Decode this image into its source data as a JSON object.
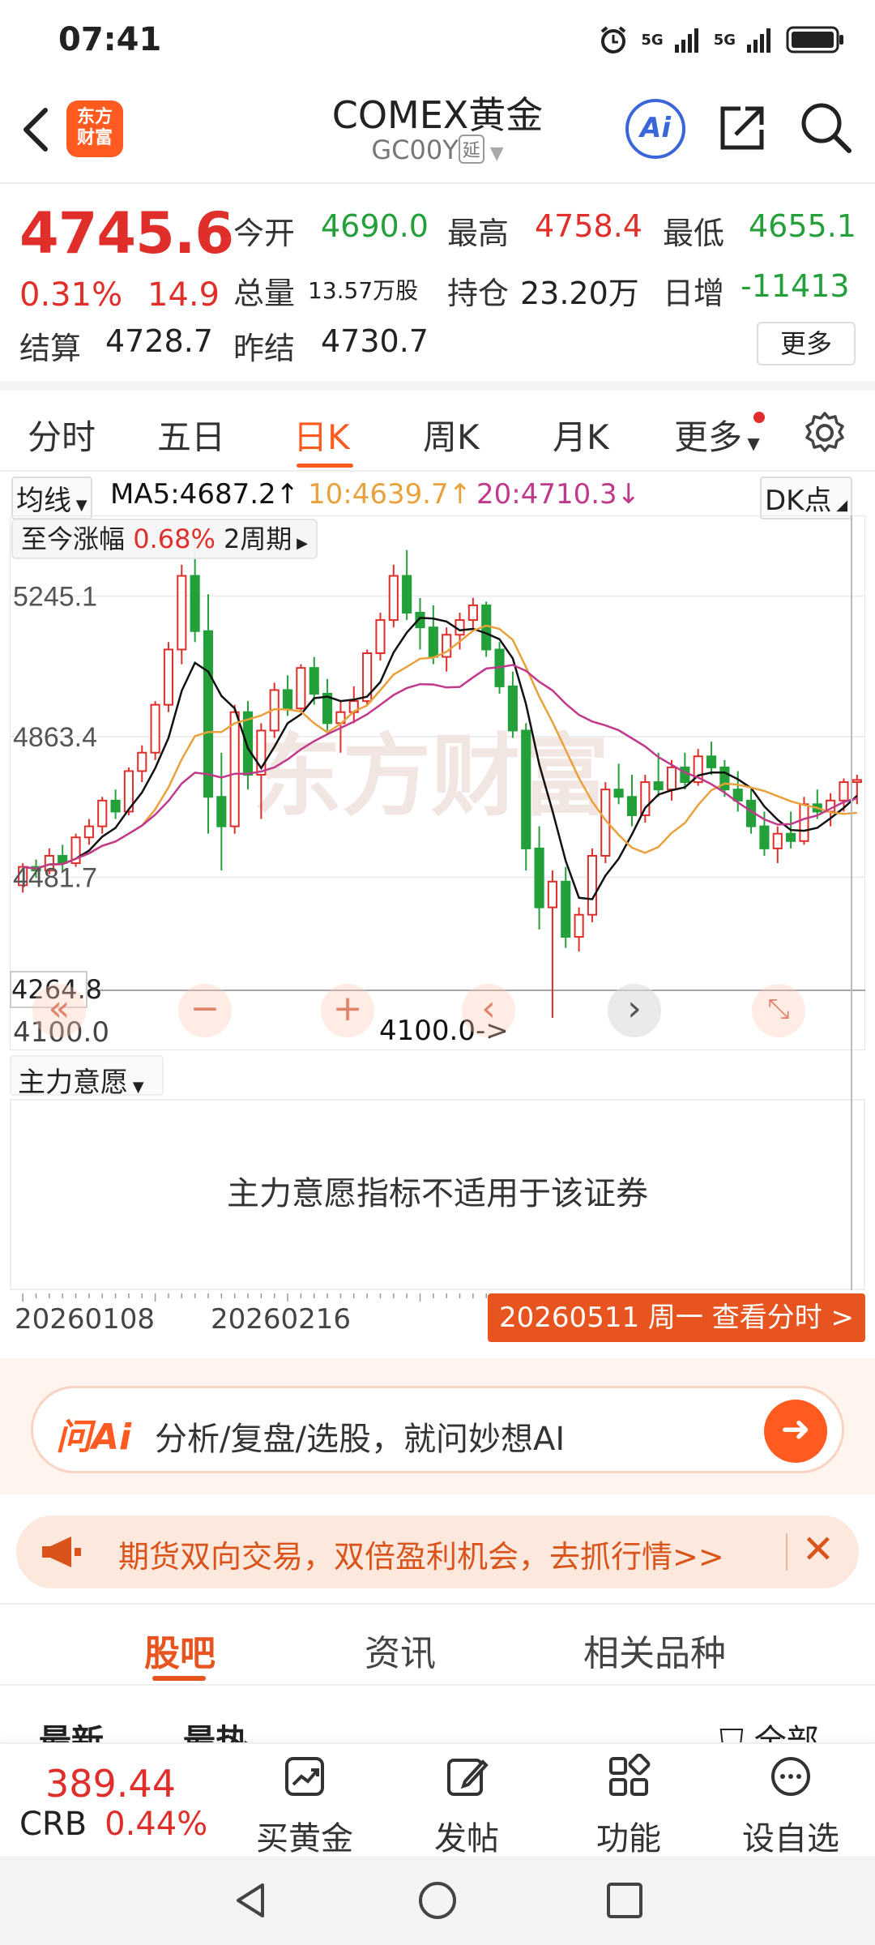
{
  "status": {
    "time": "07:41",
    "net1": "5G",
    "net2": "5G"
  },
  "header": {
    "logo_line1": "东方",
    "logo_line2": "财富",
    "title": "COMEX黄金",
    "code": "GC00Y",
    "delay_tag": "延",
    "ai_label": "Ai"
  },
  "quote": {
    "price": "4745.6",
    "change_pct": "0.31%",
    "change": "14.9",
    "open_label": "今开",
    "open": "4690.0",
    "high_label": "最高",
    "high": "4758.4",
    "low_label": "最低",
    "low": "4655.1",
    "volume_label": "总量",
    "volume": "13.57万股",
    "oi_label": "持仓",
    "oi": "23.20万",
    "daily_inc_label": "日增",
    "daily_inc": "-11413",
    "settle_label": "结算",
    "settle": "4728.7",
    "prev_settle_label": "昨结",
    "prev_settle": "4730.7",
    "more": "更多"
  },
  "tabs": [
    "分时",
    "五日",
    "日K",
    "周K",
    "月K",
    "更多"
  ],
  "active_tab": "日K",
  "indicators": {
    "ma_select": "均线",
    "ma5": "MA5:4687.2↑",
    "ma10": "10:4639.7↑",
    "ma20": "20:4710.3↓",
    "dk": "DK点",
    "range_label": "至今涨幅",
    "range_value": "0.68%",
    "range_period": "2周期"
  },
  "colors": {
    "up": "#e02f2a",
    "down": "#23a03a",
    "ma5": "#111111",
    "ma10": "#e9a23b",
    "ma20": "#c0398a",
    "accent": "#ff5a1f"
  },
  "chart_data": {
    "type": "candlestick",
    "y_ticks": [
      "5245.1",
      "4863.4",
      "4481.7"
    ],
    "ylim": [
      4100,
      5420
    ],
    "low_marker": "4100.0->",
    "crosshair_value": "4264.8",
    "bottom_value": "4100.0",
    "watermark": "东方财富",
    "ohlc": [
      [
        4460,
        4520,
        4440,
        4510
      ],
      [
        4510,
        4530,
        4480,
        4500
      ],
      [
        4500,
        4560,
        4490,
        4540
      ],
      [
        4540,
        4570,
        4500,
        4520
      ],
      [
        4520,
        4600,
        4510,
        4590
      ],
      [
        4590,
        4640,
        4570,
        4620
      ],
      [
        4620,
        4700,
        4600,
        4690
      ],
      [
        4690,
        4720,
        4640,
        4660
      ],
      [
        4660,
        4780,
        4650,
        4770
      ],
      [
        4770,
        4840,
        4740,
        4820
      ],
      [
        4820,
        4960,
        4800,
        4950
      ],
      [
        4950,
        5120,
        4930,
        5100
      ],
      [
        5100,
        5330,
        5060,
        5300
      ],
      [
        5300,
        5400,
        5120,
        5150
      ],
      [
        5150,
        5250,
        4600,
        4700
      ],
      [
        4700,
        4820,
        4500,
        4620
      ],
      [
        4620,
        4950,
        4600,
        4930
      ],
      [
        4930,
        4960,
        4720,
        4760
      ],
      [
        4760,
        4900,
        4640,
        4880
      ],
      [
        4880,
        5010,
        4860,
        4990
      ],
      [
        4990,
        5030,
        4920,
        4940
      ],
      [
        4940,
        5060,
        4930,
        5050
      ],
      [
        5050,
        5080,
        4950,
        4980
      ],
      [
        4980,
        5020,
        4880,
        4900
      ],
      [
        4900,
        4960,
        4820,
        4930
      ],
      [
        4930,
        5000,
        4900,
        4960
      ],
      [
        4960,
        5100,
        4950,
        5090
      ],
      [
        5090,
        5200,
        5070,
        5180
      ],
      [
        5180,
        5330,
        5160,
        5300
      ],
      [
        5300,
        5370,
        5180,
        5200
      ],
      [
        5200,
        5240,
        5100,
        5160
      ],
      [
        5160,
        5220,
        5060,
        5080
      ],
      [
        5080,
        5160,
        5040,
        5140
      ],
      [
        5140,
        5200,
        5100,
        5180
      ],
      [
        5180,
        5240,
        5150,
        5220
      ],
      [
        5220,
        5230,
        5080,
        5100
      ],
      [
        5100,
        5120,
        4980,
        5000
      ],
      [
        5000,
        5040,
        4860,
        4880
      ],
      [
        4880,
        4900,
        4500,
        4560
      ],
      [
        4560,
        4620,
        4340,
        4400
      ],
      [
        4400,
        4500,
        4100,
        4470
      ],
      [
        4470,
        4510,
        4290,
        4320
      ],
      [
        4320,
        4400,
        4280,
        4380
      ],
      [
        4380,
        4560,
        4360,
        4540
      ],
      [
        4540,
        4740,
        4520,
        4720
      ],
      [
        4720,
        4790,
        4680,
        4700
      ],
      [
        4700,
        4760,
        4620,
        4650
      ],
      [
        4650,
        4760,
        4630,
        4740
      ],
      [
        4740,
        4820,
        4700,
        4720
      ],
      [
        4720,
        4800,
        4690,
        4780
      ],
      [
        4780,
        4820,
        4720,
        4740
      ],
      [
        4740,
        4830,
        4730,
        4810
      ],
      [
        4810,
        4850,
        4760,
        4780
      ],
      [
        4780,
        4800,
        4700,
        4720
      ],
      [
        4720,
        4770,
        4660,
        4690
      ],
      [
        4690,
        4720,
        4600,
        4620
      ],
      [
        4620,
        4660,
        4540,
        4560
      ],
      [
        4560,
        4620,
        4520,
        4600
      ],
      [
        4600,
        4660,
        4560,
        4580
      ],
      [
        4580,
        4700,
        4570,
        4680
      ],
      [
        4680,
        4720,
        4640,
        4660
      ],
      [
        4660,
        4710,
        4620,
        4690
      ],
      [
        4690,
        4750,
        4660,
        4740
      ],
      [
        4740,
        4760,
        4680,
        4746
      ]
    ]
  },
  "sub_indicator": {
    "select": "主力意愿",
    "message": "主力意愿指标不适用于该证券"
  },
  "date_axis": {
    "d1": "20260108",
    "d2": "20260216",
    "current": "20260511 周一 查看分时 >"
  },
  "ai_bar": {
    "logo": "问Ai",
    "placeholder": "分析/复盘/选股，就问妙想AI"
  },
  "banner": {
    "text": "期货双向交易，双倍盈利机会，去抓行情>>"
  },
  "content_tabs": [
    "股吧",
    "资讯",
    "相关品种"
  ],
  "sort": {
    "latest": "最新",
    "hot": "最热",
    "filter": "全部"
  },
  "bottom": {
    "crb_value": "389.44",
    "crb_name": "CRB",
    "crb_pct": "0.44%",
    "buy": "买黄金",
    "post": "发帖",
    "func": "功能",
    "fav": "设自选"
  }
}
